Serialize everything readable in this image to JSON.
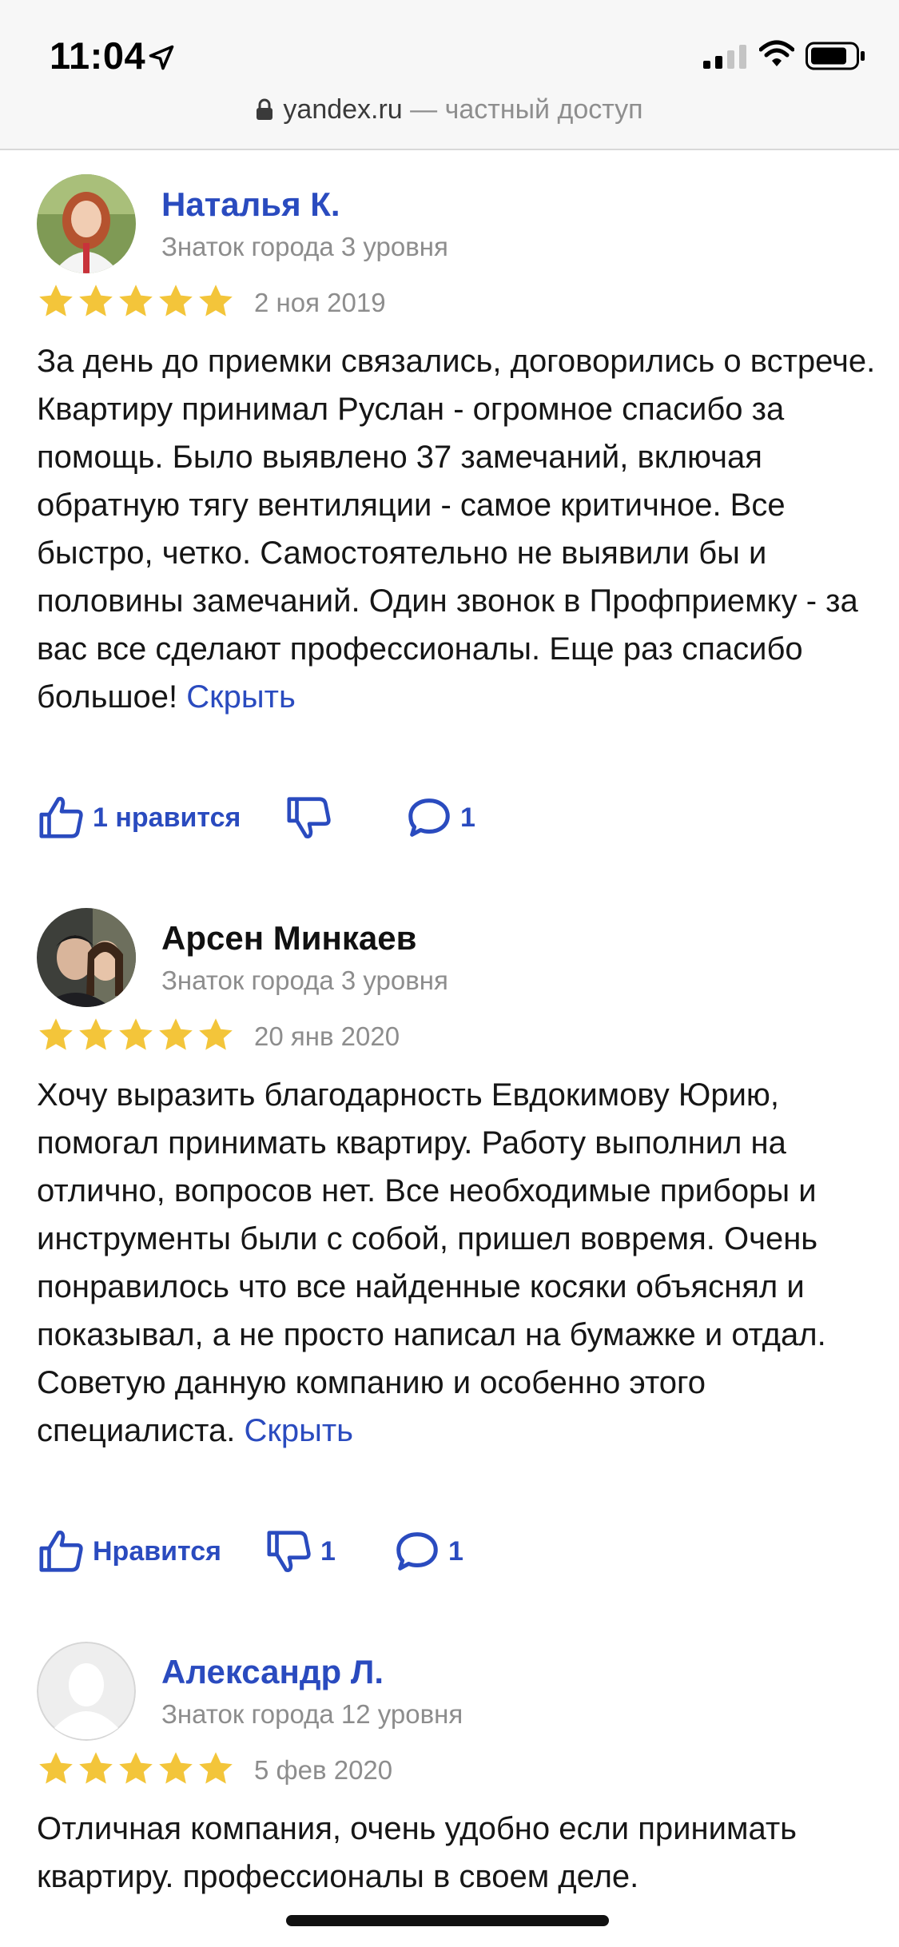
{
  "status_bar": {
    "time": "11:04"
  },
  "url_bar": {
    "domain": "yandex.ru",
    "suffix": " — частный доступ"
  },
  "colors": {
    "accent": "#2a4bbf",
    "star": "#f3c53a",
    "muted": "#8d8d8d"
  },
  "reviews": [
    {
      "author": "Наталья К.",
      "level": "Знаток города 3 уровня",
      "rating": 5,
      "date": "2 ноя 2019",
      "text": "За день до приемки связались, договорились о встрече. Квартиру принимал Руслан - огромное спасибо за помощь. Было выявлено 37 замечаний, включая обратную тягу вентиляции - самое критичное. Все быстро, четко. Самостоятельно не выявили бы и половины замечаний. Один звонок в Профприемку - за вас все сделают профессионалы. Еще раз спасибо большое!",
      "hide_label": "Скрыть",
      "likes_label": "1 нравится",
      "dislikes_label": "",
      "comments_label": "1"
    },
    {
      "author": "Арсен Минкаев",
      "level": "Знаток города 3 уровня",
      "rating": 5,
      "date": "20 янв 2020",
      "text": "Хочу выразить благодарность Евдокимову Юрию, помогал принимать квартиру. Работу выполнил на отлично, вопросов нет. Все необходимые приборы и инструменты были с собой, пришел вовремя. Очень понравилось что все найденные косяки объяснял и показывал, а не просто написал на бумажке и отдал. Советую данную компанию и особенно этого специалиста.",
      "hide_label": "Скрыть",
      "likes_label": "Нравится",
      "dislikes_label": "1",
      "comments_label": "1"
    },
    {
      "author": "Александр Л.",
      "level": "Знаток города 12 уровня",
      "rating": 5,
      "date": "5 фев 2020",
      "text": "Отличная компания, очень удобно если принимать квартиру. профессионалы в своем деле."
    }
  ]
}
